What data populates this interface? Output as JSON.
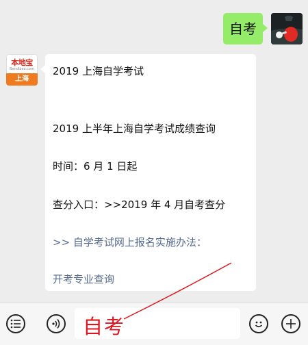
{
  "conversation": {
    "user_message": {
      "text": "自考"
    },
    "bot": {
      "avatar": {
        "logo_text": "本地宝",
        "logo_sub": "Bendibao.com",
        "city": "上海"
      },
      "lines": {
        "title": "2019 上海自学考试",
        "query_title": "2019 上半年上海自学考试成绩查询",
        "time": "时间：6 月 1 日起",
        "entry": "查分入口：>>2019 年 4 月自考查分",
        "link_prefix": ">>",
        "link_enroll": "自学考试网上报名实施办法：",
        "link_major": "开考专业查询"
      }
    }
  },
  "input_bar": {
    "input_value": "自考",
    "icons": {
      "menu": "list-menu-icon",
      "voice": "voice-icon",
      "emoji": "emoji-icon",
      "plus": "plus-icon"
    }
  },
  "colors": {
    "user_bubble": "#95ec69",
    "link": "#576b95",
    "annotation": "#e0141e"
  }
}
